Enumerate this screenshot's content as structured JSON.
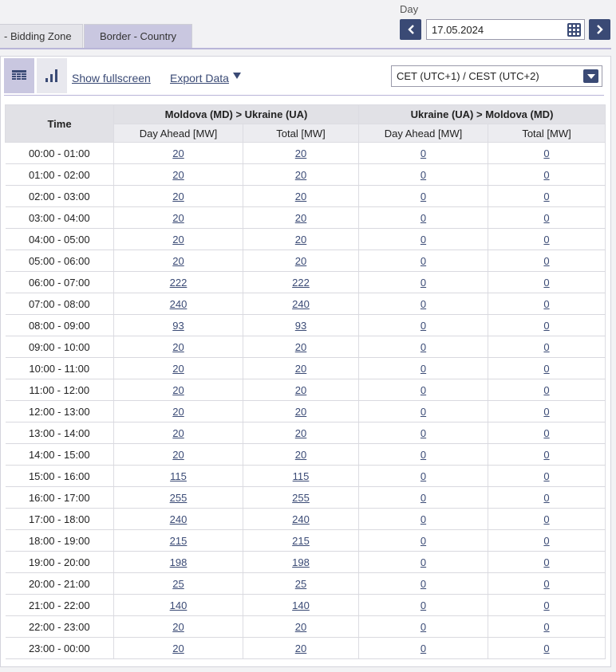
{
  "tabs": {
    "bidding_zone": "- Bidding Zone",
    "border_country": "Border - Country"
  },
  "day_picker": {
    "label": "Day",
    "date": "17.05.2024"
  },
  "toolbar": {
    "fullscreen_label": "Show fullscreen",
    "export_label": "Export Data",
    "timezone": "CET (UTC+1) / CEST (UTC+2)"
  },
  "table": {
    "time_header": "Time",
    "group1": "Moldova (MD) > Ukraine (UA)",
    "group2": "Ukraine (UA) > Moldova (MD)",
    "day_ahead_header": "Day Ahead [MW]",
    "total_header": "Total [MW]",
    "rows": [
      {
        "time": "00:00 - 01:00",
        "md_ua_da": "20",
        "md_ua_total": "20",
        "ua_md_da": "0",
        "ua_md_total": "0"
      },
      {
        "time": "01:00 - 02:00",
        "md_ua_da": "20",
        "md_ua_total": "20",
        "ua_md_da": "0",
        "ua_md_total": "0"
      },
      {
        "time": "02:00 - 03:00",
        "md_ua_da": "20",
        "md_ua_total": "20",
        "ua_md_da": "0",
        "ua_md_total": "0"
      },
      {
        "time": "03:00 - 04:00",
        "md_ua_da": "20",
        "md_ua_total": "20",
        "ua_md_da": "0",
        "ua_md_total": "0"
      },
      {
        "time": "04:00 - 05:00",
        "md_ua_da": "20",
        "md_ua_total": "20",
        "ua_md_da": "0",
        "ua_md_total": "0"
      },
      {
        "time": "05:00 - 06:00",
        "md_ua_da": "20",
        "md_ua_total": "20",
        "ua_md_da": "0",
        "ua_md_total": "0"
      },
      {
        "time": "06:00 - 07:00",
        "md_ua_da": "222",
        "md_ua_total": "222",
        "ua_md_da": "0",
        "ua_md_total": "0"
      },
      {
        "time": "07:00 - 08:00",
        "md_ua_da": "240",
        "md_ua_total": "240",
        "ua_md_da": "0",
        "ua_md_total": "0"
      },
      {
        "time": "08:00 - 09:00",
        "md_ua_da": "93",
        "md_ua_total": "93",
        "ua_md_da": "0",
        "ua_md_total": "0"
      },
      {
        "time": "09:00 - 10:00",
        "md_ua_da": "20",
        "md_ua_total": "20",
        "ua_md_da": "0",
        "ua_md_total": "0"
      },
      {
        "time": "10:00 - 11:00",
        "md_ua_da": "20",
        "md_ua_total": "20",
        "ua_md_da": "0",
        "ua_md_total": "0"
      },
      {
        "time": "11:00 - 12:00",
        "md_ua_da": "20",
        "md_ua_total": "20",
        "ua_md_da": "0",
        "ua_md_total": "0"
      },
      {
        "time": "12:00 - 13:00",
        "md_ua_da": "20",
        "md_ua_total": "20",
        "ua_md_da": "0",
        "ua_md_total": "0"
      },
      {
        "time": "13:00 - 14:00",
        "md_ua_da": "20",
        "md_ua_total": "20",
        "ua_md_da": "0",
        "ua_md_total": "0"
      },
      {
        "time": "14:00 - 15:00",
        "md_ua_da": "20",
        "md_ua_total": "20",
        "ua_md_da": "0",
        "ua_md_total": "0"
      },
      {
        "time": "15:00 - 16:00",
        "md_ua_da": "115",
        "md_ua_total": "115",
        "ua_md_da": "0",
        "ua_md_total": "0"
      },
      {
        "time": "16:00 - 17:00",
        "md_ua_da": "255",
        "md_ua_total": "255",
        "ua_md_da": "0",
        "ua_md_total": "0"
      },
      {
        "time": "17:00 - 18:00",
        "md_ua_da": "240",
        "md_ua_total": "240",
        "ua_md_da": "0",
        "ua_md_total": "0"
      },
      {
        "time": "18:00 - 19:00",
        "md_ua_da": "215",
        "md_ua_total": "215",
        "ua_md_da": "0",
        "ua_md_total": "0"
      },
      {
        "time": "19:00 - 20:00",
        "md_ua_da": "198",
        "md_ua_total": "198",
        "ua_md_da": "0",
        "ua_md_total": "0"
      },
      {
        "time": "20:00 - 21:00",
        "md_ua_da": "25",
        "md_ua_total": "25",
        "ua_md_da": "0",
        "ua_md_total": "0"
      },
      {
        "time": "21:00 - 22:00",
        "md_ua_da": "140",
        "md_ua_total": "140",
        "ua_md_da": "0",
        "ua_md_total": "0"
      },
      {
        "time": "22:00 - 23:00",
        "md_ua_da": "20",
        "md_ua_total": "20",
        "ua_md_da": "0",
        "ua_md_total": "0"
      },
      {
        "time": "23:00 - 00:00",
        "md_ua_da": "20",
        "md_ua_total": "20",
        "ua_md_da": "0",
        "ua_md_total": "0"
      }
    ]
  },
  "icons": {
    "table_view": "table-icon",
    "chart_view": "bar-chart-icon",
    "calendar": "calendar-icon",
    "prev": "chevron-left-icon",
    "next": "chevron-right-icon",
    "dropdown": "caret-down-icon"
  },
  "colors": {
    "accent": "#3a4a75",
    "active_tab": "#c9c7e0",
    "header_bg": "#e1e1e6"
  }
}
